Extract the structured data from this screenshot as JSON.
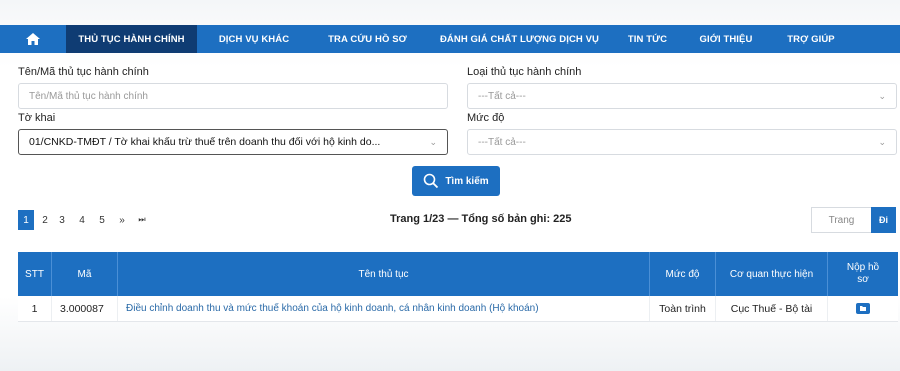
{
  "nav": {
    "home_icon": "home-icon",
    "items": [
      {
        "label": "THỦ TỤC HÀNH CHÍNH",
        "active": true
      },
      {
        "label": "DỊCH VỤ KHÁC"
      },
      {
        "label": "TRA CỨU HỒ SƠ"
      },
      {
        "label": "ĐÁNH GIÁ CHẤT LƯỢNG DỊCH VỤ"
      },
      {
        "label": "TIN TỨC"
      },
      {
        "label": "GIỚI THIỆU"
      },
      {
        "label": "TRỢ GIÚP"
      }
    ]
  },
  "form": {
    "name_label": "Tên/Mã thủ tục hành chính",
    "name_placeholder": "Tên/Mã thủ tục hành chính",
    "type_label": "Loại thủ tục hành chính",
    "type_value": "---Tất cả---",
    "declaration_label": "Tờ khai",
    "declaration_value": "01/CNKD-TMĐT / Tờ khai khấu trừ thuế trên doanh thu đối với hộ kinh do...",
    "level_label": "Mức độ",
    "level_value": "---Tất cả---",
    "search_label": "Tìm kiếm"
  },
  "pagination": {
    "pages": [
      "1",
      "2",
      "3",
      "4",
      "5",
      "»",
      "⏭"
    ],
    "summary": "Trang 1/23 — Tổng số bản ghi: 225",
    "goto_placeholder": "Trang",
    "goto_button": "Đi"
  },
  "table": {
    "headers": {
      "stt": "STT",
      "code": "Mã",
      "name": "Tên thủ tục",
      "level": "Mức độ",
      "agency": "Cơ quan thực hiện",
      "submit": "Nộp hồ sơ"
    },
    "rows": [
      {
        "stt": "1",
        "code": "3.000087",
        "name": "Điều chỉnh doanh thu và mức thuế khoán của hộ kinh doanh, cá nhân kinh doanh (Hộ khoán)",
        "level": "Toàn trình",
        "agency": "Cục Thuế - Bộ tài"
      }
    ]
  },
  "colors": {
    "primary": "#1d6fc1",
    "nav_active": "#0f3c73"
  }
}
